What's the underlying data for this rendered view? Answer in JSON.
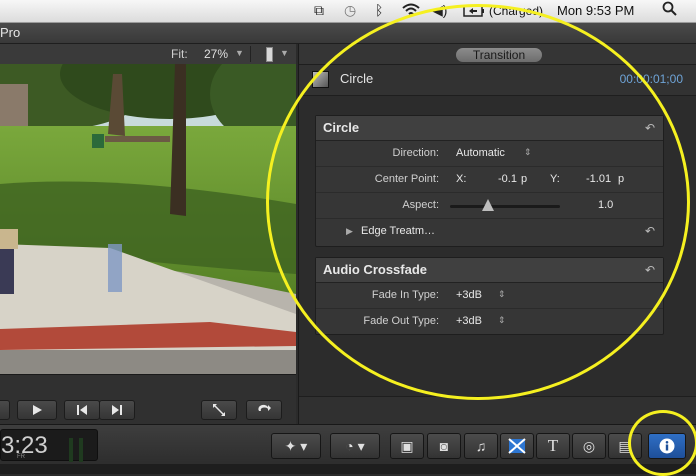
{
  "menubar": {
    "battery_text": "(Charged)",
    "clock": "Mon 9:53 PM",
    "icons": [
      "dropbox-icon",
      "time-machine-icon",
      "bluetooth-icon",
      "wifi-icon",
      "volume-icon",
      "battery-icon",
      "spotlight-icon"
    ]
  },
  "app": {
    "title": "Pro"
  },
  "viewer": {
    "fit_label": "Fit:",
    "zoom": "27%",
    "timecode": "3:23",
    "timecode_unit": "FR"
  },
  "inspector": {
    "tab": "Transition",
    "clip_name": "Circle",
    "clip_time": "00:00:01;00",
    "sections": {
      "circle": {
        "title": "Circle",
        "direction_label": "Direction:",
        "direction_value": "Automatic",
        "center_label": "Center Point:",
        "x_label": "X:",
        "x_value": "-0.1",
        "x_unit": "p",
        "y_label": "Y:",
        "y_value": "-1.01",
        "y_unit": "p",
        "aspect_label": "Aspect:",
        "aspect_value": "1.0",
        "edge_label": "Edge Treatm…"
      },
      "audio": {
        "title": "Audio Crossfade",
        "fade_in_label": "Fade In Type:",
        "fade_in_value": "+3dB",
        "fade_out_label": "Fade Out Type:",
        "fade_out_value": "+3dB"
      }
    }
  },
  "accent_colors": {
    "annotation": "#f5f020",
    "timecode_blue": "#6ea3d6",
    "inspector_button": "#2f6fc5"
  }
}
